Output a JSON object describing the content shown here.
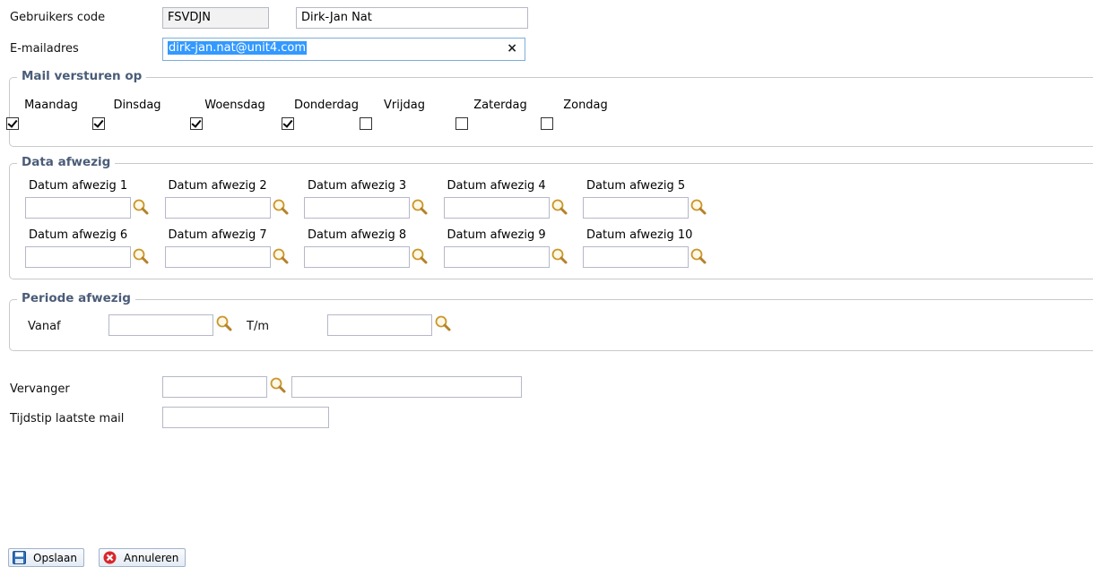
{
  "user": {
    "code_label": "Gebruikers code",
    "code_value": "FSVDJN",
    "name_value": "Dirk-Jan Nat",
    "email_label": "E-mailadres",
    "email_value": "dirk-jan.nat@unit4.com",
    "clear_glyph": "×"
  },
  "mail_days": {
    "legend": "Mail versturen op",
    "days": [
      {
        "label": "Maandag",
        "checked": true
      },
      {
        "label": "Dinsdag",
        "checked": true
      },
      {
        "label": "Woensdag",
        "checked": true
      },
      {
        "label": "Donderdag",
        "checked": true
      },
      {
        "label": "Vrijdag",
        "checked": false
      },
      {
        "label": "Zaterdag",
        "checked": false
      },
      {
        "label": "Zondag",
        "checked": false
      }
    ]
  },
  "absent_dates": {
    "legend": "Data afwezig",
    "fields": [
      {
        "label": "Datum afwezig 1",
        "value": ""
      },
      {
        "label": "Datum afwezig 2",
        "value": ""
      },
      {
        "label": "Datum afwezig 3",
        "value": ""
      },
      {
        "label": "Datum afwezig 4",
        "value": ""
      },
      {
        "label": "Datum afwezig 5",
        "value": ""
      },
      {
        "label": "Datum afwezig 6",
        "value": ""
      },
      {
        "label": "Datum afwezig 7",
        "value": ""
      },
      {
        "label": "Datum afwezig 8",
        "value": ""
      },
      {
        "label": "Datum afwezig 9",
        "value": ""
      },
      {
        "label": "Datum afwezig 10",
        "value": ""
      }
    ]
  },
  "absent_period": {
    "legend": "Periode afwezig",
    "from_label": "Vanaf",
    "from_value": "",
    "to_label": "T/m",
    "to_value": ""
  },
  "replacement": {
    "label": "Vervanger",
    "code_value": "",
    "name_value": ""
  },
  "last_mail": {
    "label": "Tijdstip laatste mail",
    "value": ""
  },
  "buttons": {
    "save_label": "Opslaan",
    "cancel_label": "Annuleren"
  },
  "colors": {
    "legend_text": "#4a5c78",
    "selection": "#3399ff",
    "cancel_icon": "#d9262b",
    "save_icon": "#2f6fb8"
  }
}
